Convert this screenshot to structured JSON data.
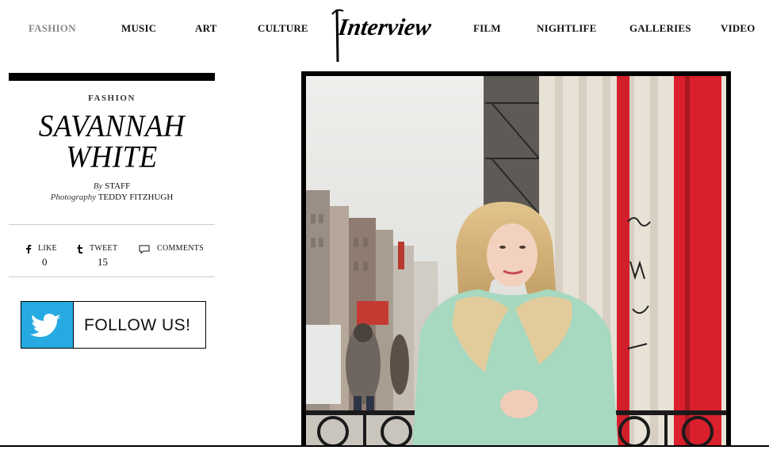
{
  "nav": {
    "left": [
      "FASHION",
      "MUSIC",
      "ART",
      "CULTURE"
    ],
    "right": [
      "FILM",
      "NIGHTLIFE",
      "GALLERIES",
      "VIDEO"
    ],
    "logo": "Interview"
  },
  "article": {
    "category": "FASHION",
    "title_line1": "SAVANNAH",
    "title_line2": "WHITE",
    "by_label": "By",
    "by_name": "STAFF",
    "photo_label": "Photography",
    "photo_name": "TEDDY FITZHUGH"
  },
  "share": {
    "like_label": "LIKE",
    "like_count": "0",
    "tweet_label": "TWEET",
    "tweet_count": "15",
    "comments_label": "COMMENTS"
  },
  "follow": {
    "label": "FOLLOW US!"
  },
  "colors": {
    "twitter": "#27aae1",
    "nav_active": "#888888"
  }
}
